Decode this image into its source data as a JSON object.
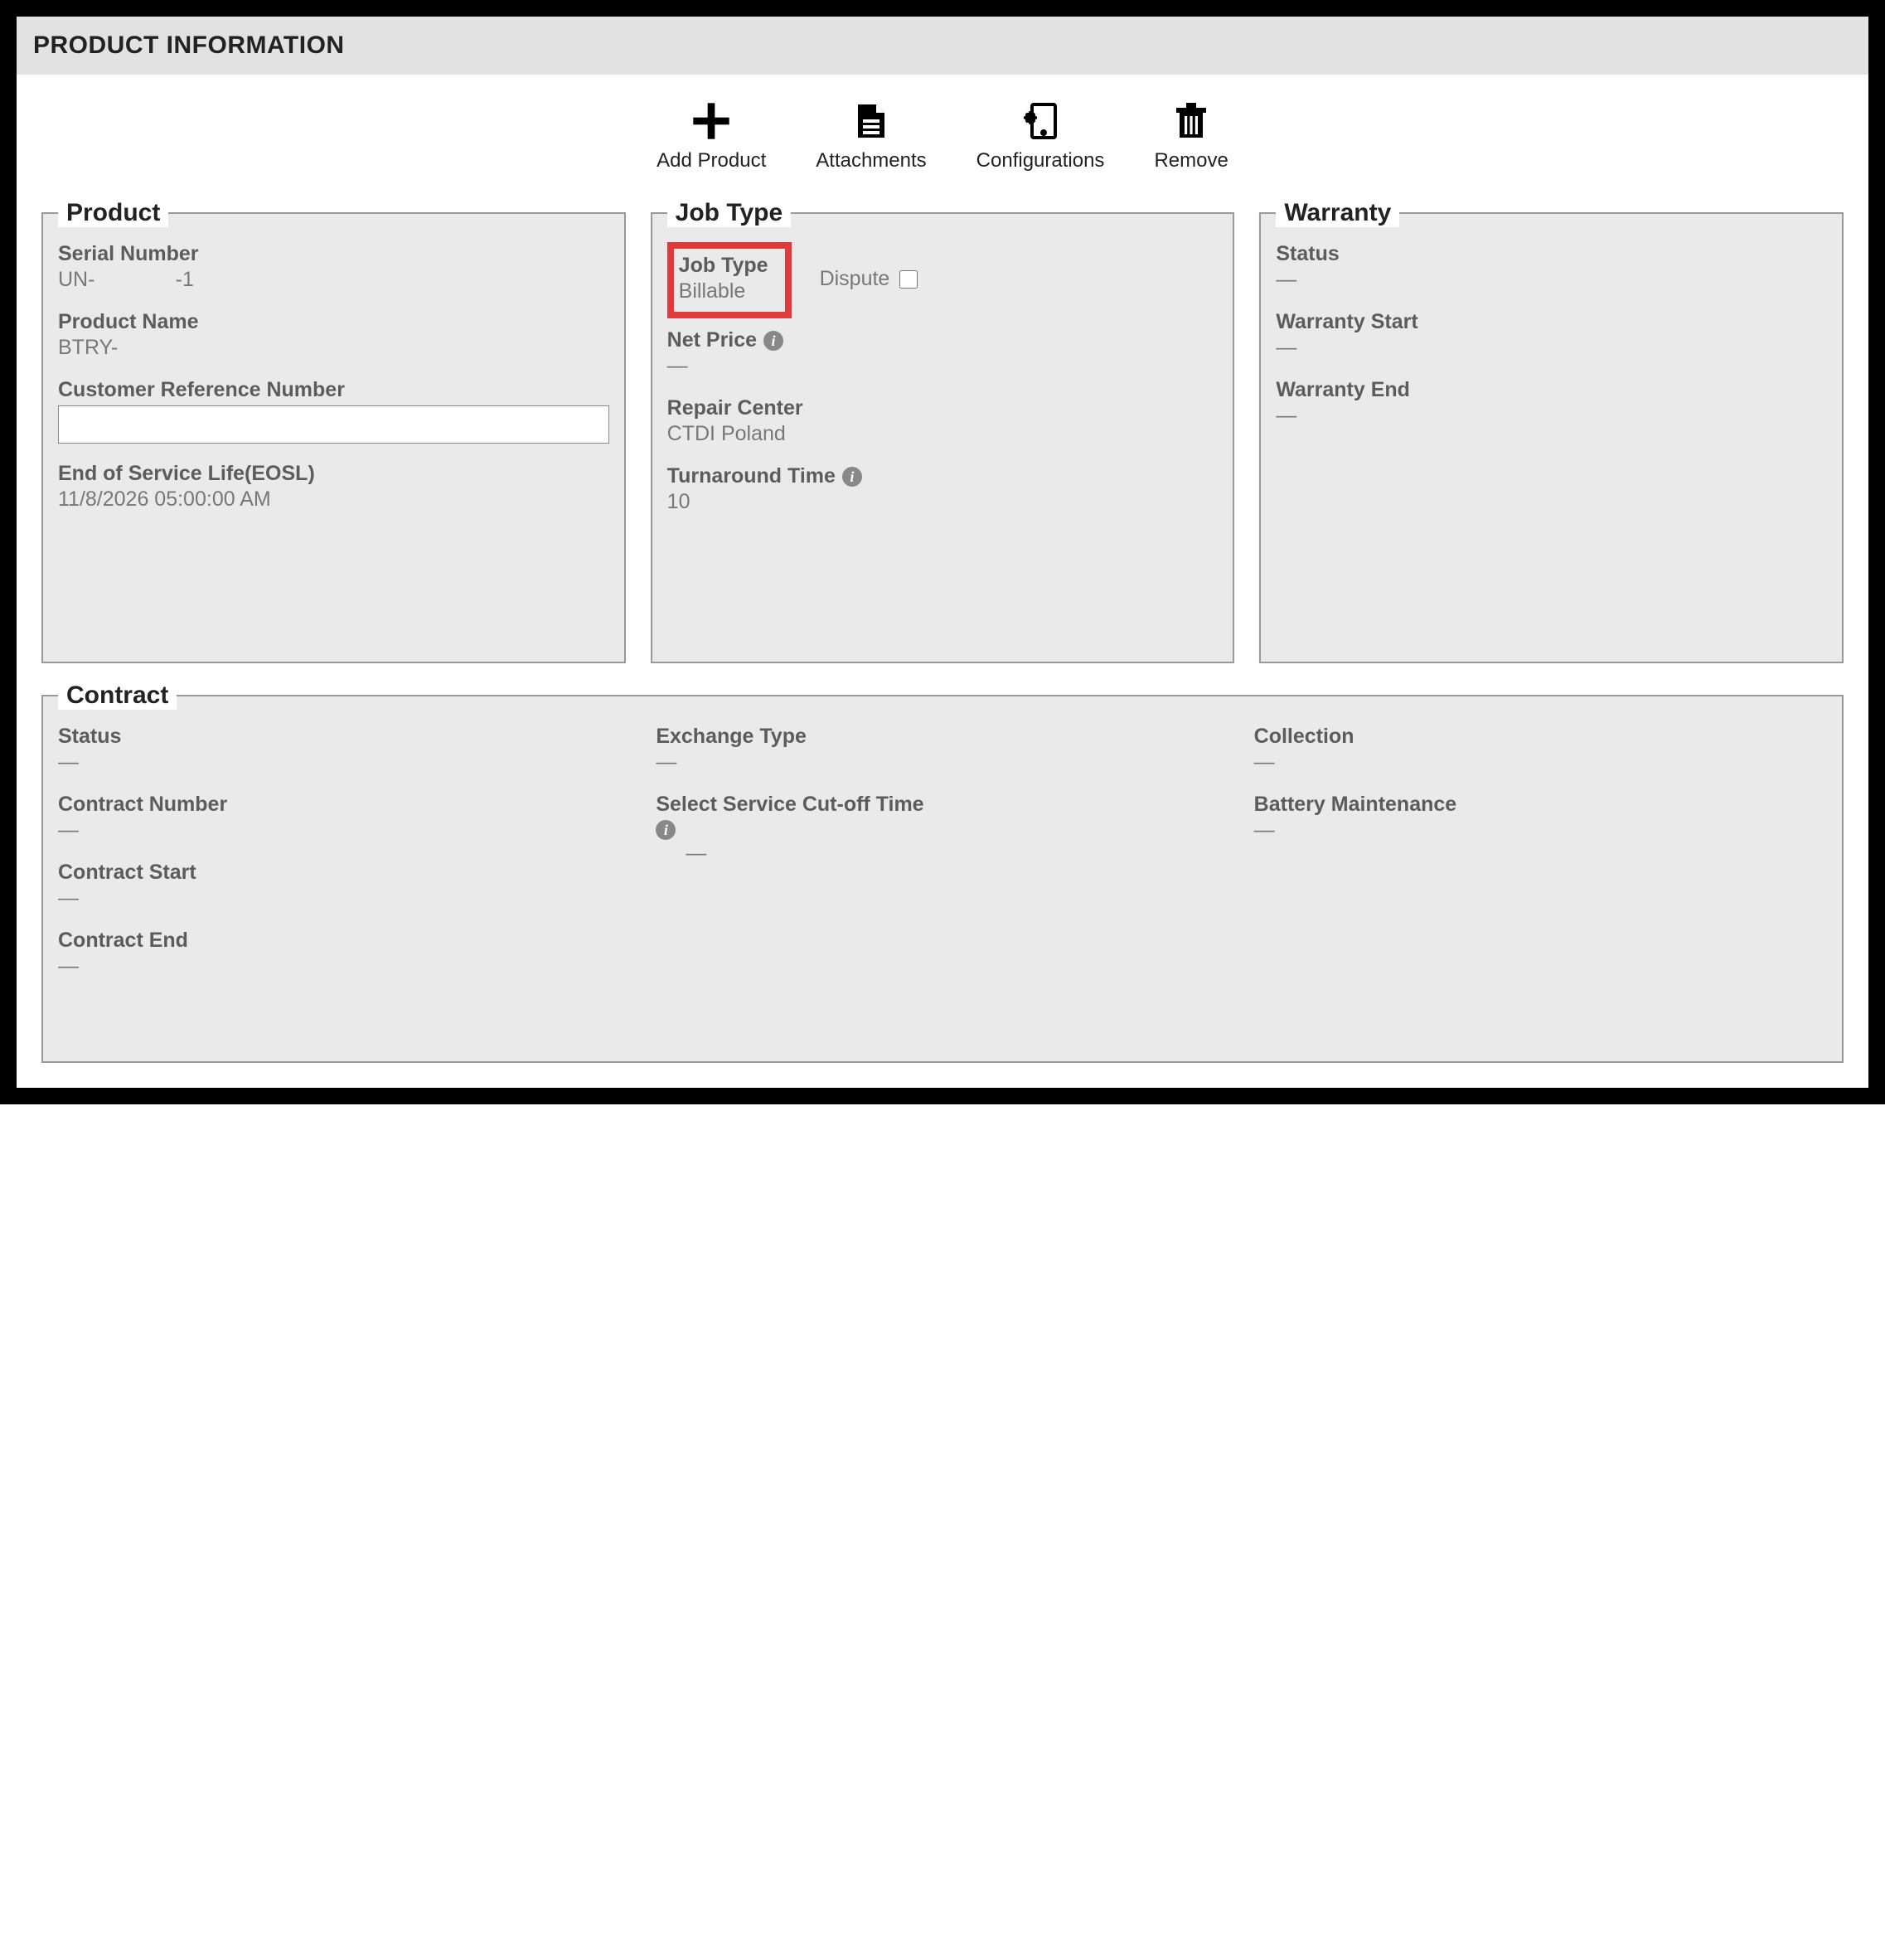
{
  "header": {
    "title": "PRODUCT INFORMATION"
  },
  "toolbar": {
    "add_product": "Add Product",
    "attachments": "Attachments",
    "configurations": "Configurations",
    "remove": "Remove"
  },
  "product_panel": {
    "legend": "Product",
    "serial_number_label": "Serial Number",
    "serial_number_value": "UN-              -1",
    "product_name_label": "Product Name",
    "product_name_value": "BTRY-",
    "customer_ref_label": "Customer Reference Number",
    "customer_ref_value": "",
    "eosl_label": "End of Service Life(EOSL)",
    "eosl_value": "11/8/2026 05:00:00 AM"
  },
  "jobtype_panel": {
    "legend": "Job Type",
    "job_type_label": "Job Type",
    "job_type_value": "Billable",
    "dispute_label": "Dispute",
    "net_price_label": "Net Price",
    "net_price_value": "—",
    "repair_center_label": "Repair Center",
    "repair_center_value": "CTDI Poland",
    "turnaround_label": "Turnaround Time",
    "turnaround_value": "10"
  },
  "warranty_panel": {
    "legend": "Warranty",
    "status_label": "Status",
    "status_value": "—",
    "warranty_start_label": "Warranty Start",
    "warranty_start_value": "—",
    "warranty_end_label": "Warranty End",
    "warranty_end_value": "—"
  },
  "contract_panel": {
    "legend": "Contract",
    "status_label": "Status",
    "status_value": "—",
    "contract_number_label": "Contract Number",
    "contract_number_value": "—",
    "contract_start_label": "Contract Start",
    "contract_start_value": "—",
    "contract_end_label": "Contract End",
    "contract_end_value": "—",
    "exchange_type_label": "Exchange Type",
    "exchange_type_value": "—",
    "cutoff_label": "Select Service Cut-off Time",
    "cutoff_value": "—",
    "collection_label": "Collection",
    "collection_value": "—",
    "battery_maint_label": "Battery Maintenance",
    "battery_maint_value": "—"
  }
}
